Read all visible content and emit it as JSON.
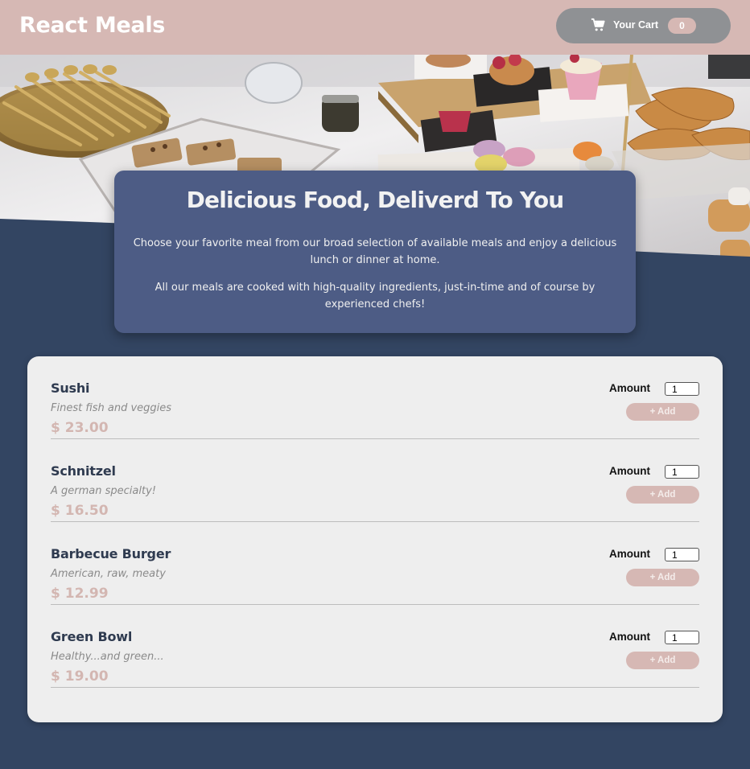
{
  "header": {
    "brand": "React Meals",
    "cart": {
      "label": "Your Cart",
      "count": "0"
    }
  },
  "summary": {
    "title": "Delicious Food, Deliverd To You",
    "paragraph1": "Choose your favorite meal from our broad selection of available meals and enjoy a delicious lunch or dinner at home.",
    "paragraph2": "All our meals are cooked with high-quality ingredients, just-in-time and of course by experienced chefs!"
  },
  "meals": [
    {
      "name": "Sushi",
      "description": "Finest fish and veggies",
      "price": "$ 23.00",
      "amount_label": "Amount",
      "amount": "1",
      "add_label": "+ Add"
    },
    {
      "name": "Schnitzel",
      "description": "A german specialty!",
      "price": "$ 16.50",
      "amount_label": "Amount",
      "amount": "1",
      "add_label": "+ Add"
    },
    {
      "name": "Barbecue Burger",
      "description": "American, raw, meaty",
      "price": "$ 12.99",
      "amount_label": "Amount",
      "amount": "1",
      "add_label": "+ Add"
    },
    {
      "name": "Green Bowl",
      "description": "Healthy...and green...",
      "price": "$ 19.00",
      "amount_label": "Amount",
      "amount": "1",
      "add_label": "+ Add"
    }
  ],
  "colors": {
    "header": "#d6b8b4",
    "background": "#334562",
    "summary_card": "#4d5c85",
    "meals_card": "#eeeeee",
    "price": "#d3b6b1",
    "cart_button": "#8f9194"
  },
  "icons": {
    "cart": "shopping-cart-icon"
  }
}
